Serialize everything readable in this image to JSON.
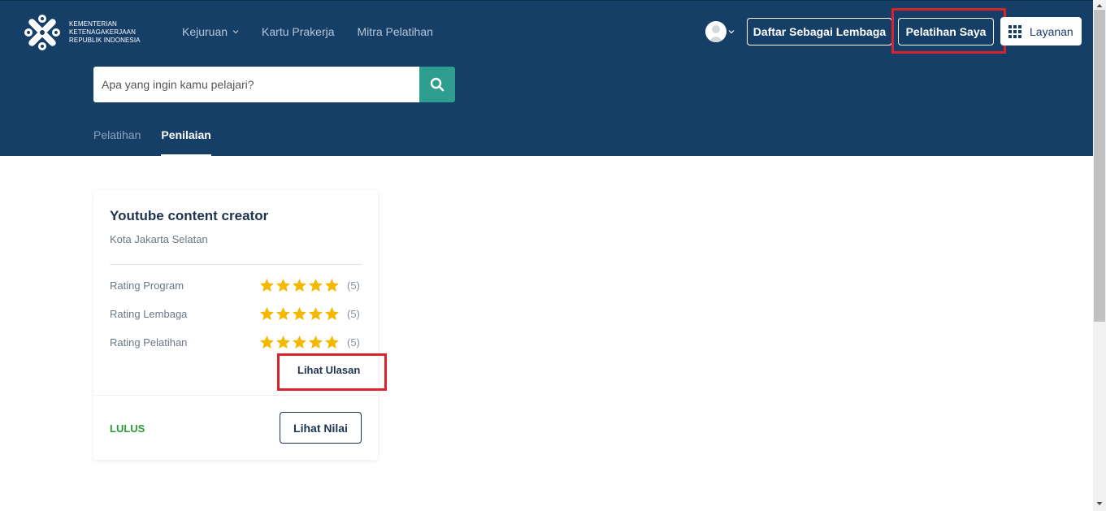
{
  "header": {
    "logo_lines": [
      "KEMENTERIAN",
      "KETENAGAKERJAAN",
      "REPUBLIK INDONESIA"
    ],
    "nav": [
      {
        "label": "Kejuruan",
        "has_dropdown": true
      },
      {
        "label": "Kartu Prakerja"
      },
      {
        "label": "Mitra Pelatihan"
      }
    ],
    "daftar_label": "Daftar Sebagai Lembaga",
    "pelatihan_saya_label": "Pelatihan Saya",
    "layanan_label": "Layanan"
  },
  "search": {
    "placeholder": "Apa yang ingin kamu pelajari?"
  },
  "tabs": [
    {
      "label": "Pelatihan",
      "active": false
    },
    {
      "label": "Penilaian",
      "active": true
    }
  ],
  "card": {
    "title": "Youtube content creator",
    "location": "Kota Jakarta Selatan",
    "ratings": [
      {
        "label": "Rating Program",
        "stars": 5,
        "count": "(5)"
      },
      {
        "label": "Rating Lembaga",
        "stars": 5,
        "count": "(5)"
      },
      {
        "label": "Rating Pelatihan",
        "stars": 5,
        "count": "(5)"
      }
    ],
    "ulasan_label": "Lihat Ulasan",
    "status": "LULUS",
    "nilai_label": "Lihat Nilai"
  },
  "colors": {
    "header_bg": "#163f68",
    "search_button": "#2d9e8f",
    "star": "#f5b800",
    "status_pass": "#2e9a3c",
    "highlight": "#d9232d"
  }
}
